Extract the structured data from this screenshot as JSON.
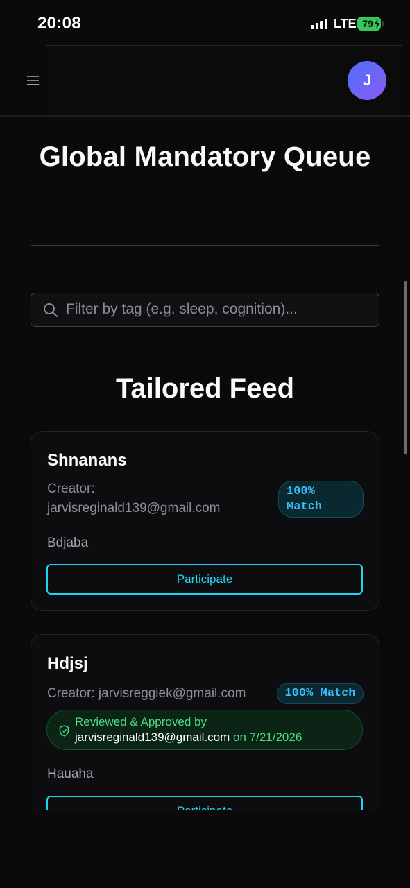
{
  "status_bar": {
    "time": "20:08",
    "network": "LTE",
    "battery": "79"
  },
  "header": {
    "avatar_initial": "J"
  },
  "page_title": "Global Mandatory Queue",
  "search": {
    "placeholder": "Filter by tag (e.g. sleep, cognition)..."
  },
  "feed": {
    "title": "Tailored Feed",
    "cards": [
      {
        "title": "Shnanans",
        "creator_label": "Creator:",
        "creator_email": "jarvisreginald139@gmail.com",
        "match_value": "100%",
        "match_word": "Match",
        "description": "Bdjaba",
        "action": "Participate"
      },
      {
        "title": "Hdjsj",
        "creator_label": "Creator:",
        "creator_email": "jarvisreggiek@gmail.com",
        "match": "100% Match",
        "approval": {
          "prefix": "Reviewed & Approved by",
          "approver": "jarvisreginald139@gmail.com",
          "on_word": "on",
          "date": "7/21/2026"
        },
        "description": "Hauaha",
        "action": "Participate"
      }
    ]
  },
  "colors": {
    "accent": "#22d3ee",
    "approved": "#4ade80",
    "avatar_start": "#4f6ef7",
    "avatar_end": "#8b5cf6"
  }
}
